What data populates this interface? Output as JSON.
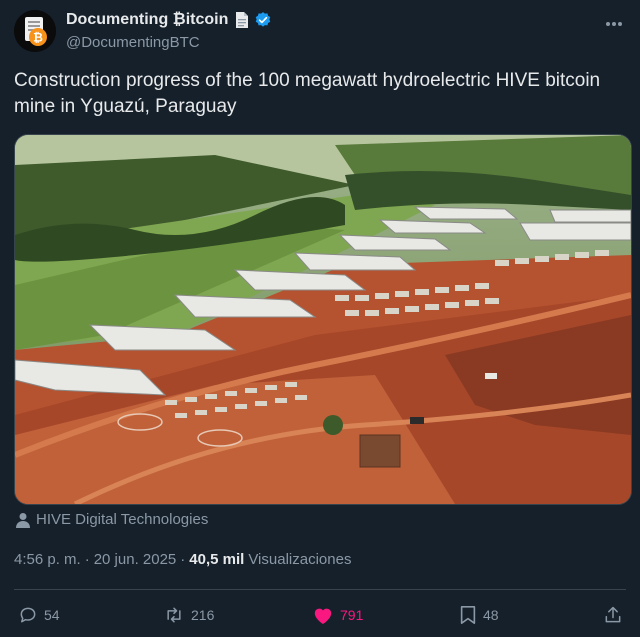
{
  "header": {
    "display_name": "Documenting ₿itcoin",
    "handle": "@DocumentingBTC",
    "avatar_icon": "bitcoin-document-icon",
    "badge_icon": "document-emoji-icon",
    "verified_icon": "verified-badge-icon"
  },
  "tweet": {
    "text": "Construction progress of the 100 megawatt hydroelectric HIVE bitcoin mine in Yguazú, Paraguay"
  },
  "media": {
    "image_icon": "aerial-photo-bitcoin-mine",
    "credit": "HIVE Digital Technologies"
  },
  "meta": {
    "time": "4:56 p. m.",
    "date": "20 jun. 2025",
    "views_count": "40,5 mil",
    "views_label": "Visualizaciones"
  },
  "actions": {
    "replies": "54",
    "reposts": "216",
    "likes": "791",
    "bookmarks": "48"
  },
  "colors": {
    "background": "#15202b",
    "text": "#e7e9ea",
    "secondary": "#8b98a5",
    "like": "#f91880",
    "verified": "#1d9bf0",
    "bitcoin": "#f7931a"
  }
}
